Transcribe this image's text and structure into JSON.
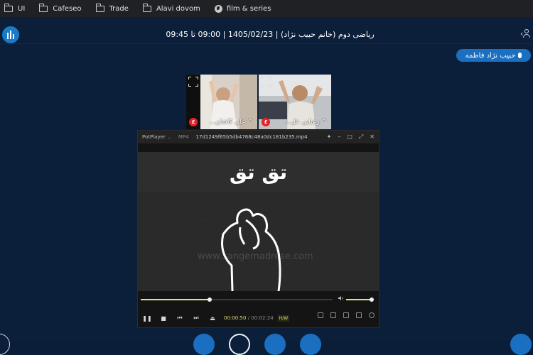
{
  "bookmarks": [
    {
      "label": "UI",
      "icon": "folder-icon"
    },
    {
      "label": "Cafeseo",
      "icon": "folder-icon"
    },
    {
      "label": "Trade",
      "icon": "folder-icon"
    },
    {
      "label": "Alavi dovom",
      "icon": "folder-icon"
    },
    {
      "label": "film & series",
      "icon": "globe-icon"
    }
  ],
  "header": {
    "session_title": "ریاضی دوم (خانم حبیب نژاد) | 1405/02/23 | 09:00 تا 09:45"
  },
  "speaker": {
    "name": "حبیب نژاد فاطمه"
  },
  "tiles": [
    {
      "name": "علی کاشان...",
      "chevron": "^"
    },
    {
      "name": "رعنایی عل...",
      "chevron": "^"
    }
  ],
  "player": {
    "brand": "PotPlayer",
    "format": "MP4",
    "filename": "17d1249f65b5db4768c48a0dc181b235.mp4",
    "overlay_word": "تق تق",
    "watermark": "www.sangemadrese.com",
    "time_current": "00:00:50",
    "time_total": "00:02:24",
    "decoder": "H/W",
    "seek_progress": 0.36,
    "volume_level": 1.0
  },
  "colors": {
    "background": "#0b1f3a",
    "accent": "#1b6fc0",
    "seek": "#e8e089"
  }
}
